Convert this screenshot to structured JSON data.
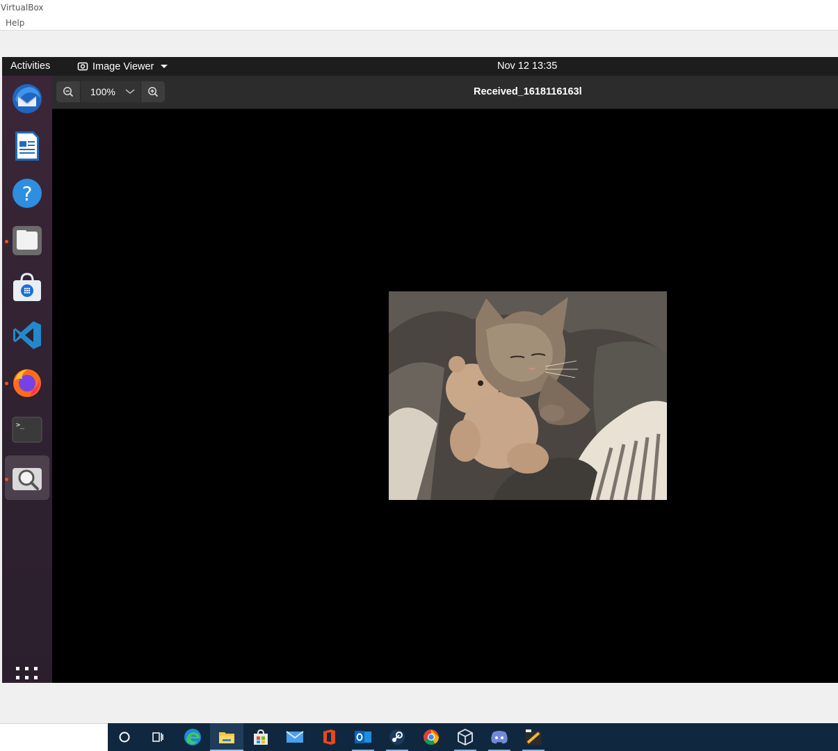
{
  "host": {
    "title": "VirtualBox",
    "menu": [
      "Help"
    ]
  },
  "topbar": {
    "activities": "Activities",
    "app_menu": "Image Viewer",
    "clock": "Nov 12  13:35"
  },
  "dock": {
    "items": [
      {
        "name": "thunderbird-icon",
        "running": false
      },
      {
        "name": "libreoffice-writer-icon",
        "running": false
      },
      {
        "name": "help-icon",
        "running": false
      },
      {
        "name": "files-icon",
        "running": true
      },
      {
        "name": "software-store-icon",
        "running": false
      },
      {
        "name": "vscode-icon",
        "running": false
      },
      {
        "name": "firefox-icon",
        "running": true
      },
      {
        "name": "terminal-icon",
        "running": false
      },
      {
        "name": "image-viewer-icon",
        "running": true,
        "active": true
      }
    ],
    "show_apps": "apps-grid-icon"
  },
  "viewer": {
    "zoom": "100%",
    "title": "Received_1618116163l"
  },
  "taskbar": {
    "items": [
      "search-circle-icon",
      "task-view-icon",
      "edge-icon",
      "file-explorer-icon",
      "store-icon",
      "mail-icon",
      "office-icon",
      "outlook-icon",
      "steam-icon",
      "chrome-icon",
      "virtualbox-icon",
      "discord-icon",
      "app-icon"
    ],
    "colors": {
      "taskbar": "#10283f",
      "accent": "#e95420"
    }
  }
}
